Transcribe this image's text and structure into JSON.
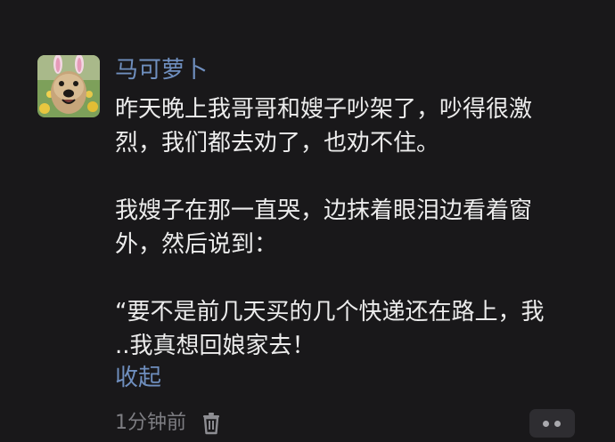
{
  "post": {
    "username": "马可萝卜",
    "content_lines": [
      "昨天晚上我哥哥和嫂子吵架了，吵得很激",
      "烈，我们都去劝了，也劝不住。",
      "",
      "我嫂子在那一直哭，边抹着眼泪边看着窗",
      "外，然后说到：",
      "",
      "“要不是前几天买的几个快递还在路上，我",
      "..我真想回娘家去！"
    ],
    "collapse_label": "收起",
    "time": "1分钟前",
    "delete_icon": "trash-icon",
    "more_icon": "more-dots-icon"
  },
  "colors": {
    "background": "#19181a",
    "text": "#ececec",
    "link": "#6f8fbf",
    "muted": "#7d7d82"
  }
}
